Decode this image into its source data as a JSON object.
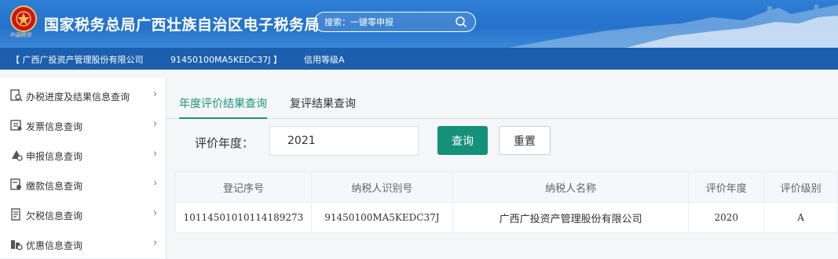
{
  "header": {
    "emblem_text": "中国税务",
    "title": "国家税务总局广西壮族自治区电子税务局",
    "search_placeholder": "搜索：一键零申报"
  },
  "infobar": {
    "company": "【 广西广投资产管理股份有限公司",
    "tax_id": "91450100MA5KEDC37J 】",
    "credit": "信用等级A"
  },
  "sidebar": {
    "items": [
      {
        "label": "办税进度及结果信息查询",
        "icon": "search-doc-icon"
      },
      {
        "label": "发票信息查询",
        "icon": "invoice-icon"
      },
      {
        "label": "申报信息查询",
        "icon": "declaration-icon"
      },
      {
        "label": "缴款信息查询",
        "icon": "payment-icon"
      },
      {
        "label": "欠税信息查询",
        "icon": "arrears-icon"
      },
      {
        "label": "优惠信息查询",
        "icon": "discount-icon"
      }
    ],
    "chevron": "›"
  },
  "tabs": [
    {
      "label": "年度评价结果查询",
      "active": true
    },
    {
      "label": "复评结果查询",
      "active": false
    }
  ],
  "form": {
    "year_label": "评价年度：",
    "year_value": "2021",
    "query_button": "查询",
    "reset_button": "重置"
  },
  "table": {
    "headers": [
      "登记序号",
      "纳税人识别号",
      "纳税人名称",
      "评价年度",
      "评价级别"
    ],
    "rows": [
      [
        "10114501010114189273",
        "91450100MA5KEDC37J",
        "广西广投资产管理股份有限公司",
        "2020",
        "A"
      ]
    ]
  },
  "colors": {
    "header_blue": "#2472cb",
    "infobar_blue": "#1b5fae",
    "accent_green": "#159079"
  }
}
